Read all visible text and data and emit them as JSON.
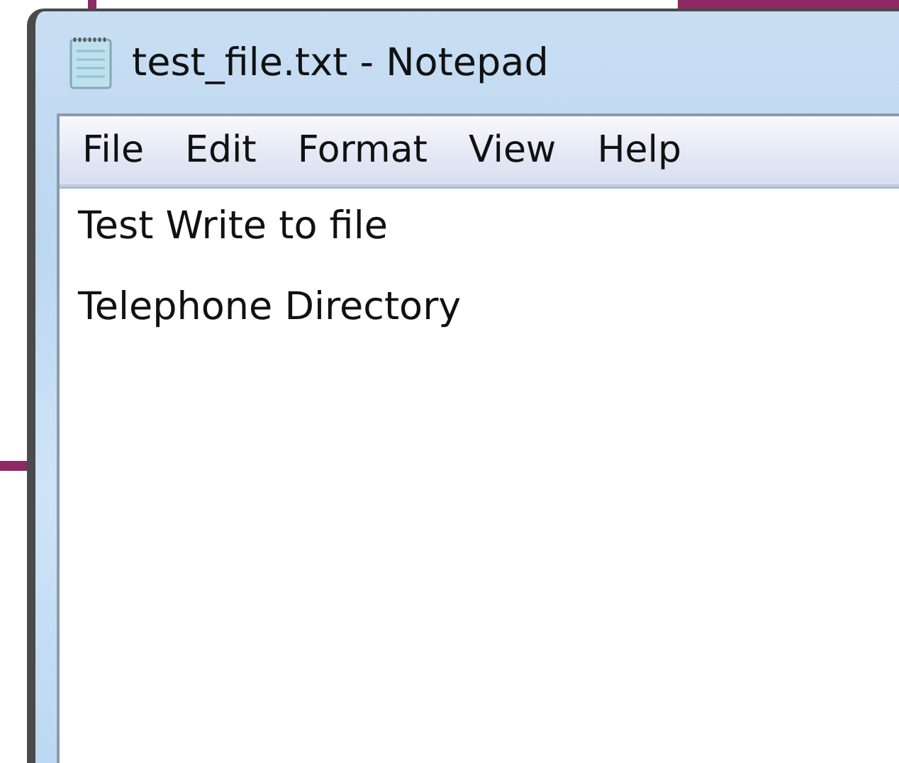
{
  "window": {
    "title": "test_file.txt - Notepad"
  },
  "menu": [
    {
      "label": "File"
    },
    {
      "label": "Edit"
    },
    {
      "label": "Format"
    },
    {
      "label": "View"
    },
    {
      "label": "Help"
    }
  ],
  "editor": {
    "lines": [
      "Test Write to file",
      "Telephone Directory"
    ]
  }
}
